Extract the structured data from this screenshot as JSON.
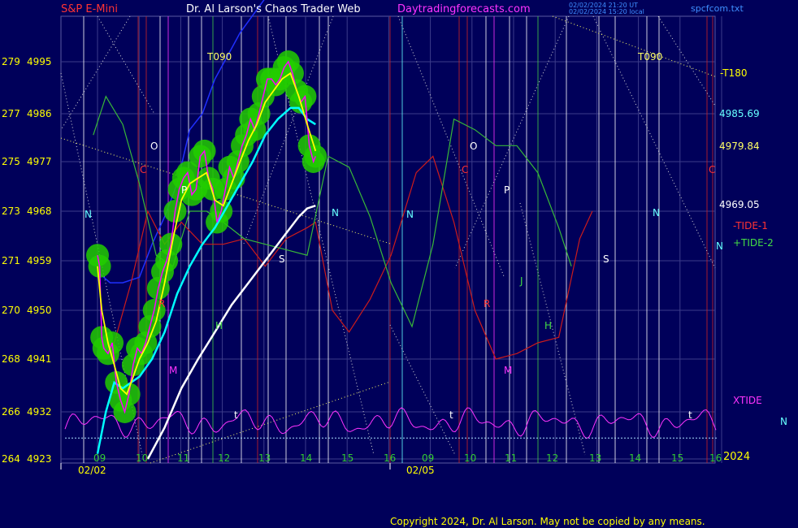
{
  "header": {
    "symbol": "S&P E-Mini",
    "title": "Dr. Al Larson's Chaos Trader Web",
    "site": "Daytradingforecasts.com",
    "stamp1": "02/02/2024 21:20 UT",
    "stamp2": "02/02/2024 15:20 local",
    "file": "spcfcom.txt"
  },
  "footer": {
    "copyright": "Copyright 2024, Dr. Al Larson. May not be copied by any means."
  },
  "colors": {
    "background": "#00005a",
    "grid": "#3c3c8a",
    "price": "#ffff00",
    "ma_fast": "#ff00ff",
    "ma_slow": "#00ffff",
    "halo": "#22cc00",
    "tide1": "#cc1b1b",
    "tide2": "#38b838",
    "xtide": "#ff33ff",
    "long_avg": "#ffffff",
    "blue_line": "#2030ff"
  },
  "chart_data": {
    "type": "line",
    "title": "S&P E-Mini",
    "y_axis": {
      "ticks": [
        {
          "planet": "264",
          "price": "4923"
        },
        {
          "planet": "266",
          "price": "4932"
        },
        {
          "planet": "268",
          "price": "4941"
        },
        {
          "planet": "270",
          "price": "4950"
        },
        {
          "planet": "271",
          "price": "4959"
        },
        {
          "planet": "273",
          "price": "4968"
        },
        {
          "planet": "275",
          "price": "4977"
        },
        {
          "planet": "277",
          "price": "4986"
        },
        {
          "planet": "279",
          "price": "4995"
        }
      ],
      "range": [
        4923,
        5000
      ]
    },
    "x_axis": {
      "hour_labels_day1": [
        "09",
        "10",
        "11",
        "12",
        "13",
        "14",
        "15",
        "16"
      ],
      "hour_labels_day2": [
        "09",
        "10",
        "11",
        "12",
        "13",
        "14",
        "15",
        "16"
      ],
      "date_labels": [
        "02/02",
        "02/05"
      ],
      "year_label": "2024"
    },
    "right_labels": [
      {
        "text": "-T180",
        "value": 4996
      },
      {
        "text": "4985.69",
        "value": 4985.69
      },
      {
        "text": "4979.84",
        "value": 4979.84
      },
      {
        "text": "4969.05",
        "value": 4969.05
      }
    ],
    "legend": [
      "-TIDE-1",
      "+TIDE-2",
      "XTIDE",
      "N"
    ],
    "markers": [
      "T090",
      "T090",
      "O",
      "O",
      "P",
      "P",
      "C",
      "C",
      "C",
      "N",
      "N",
      "N",
      "N",
      "N",
      "S",
      "S",
      "H",
      "H",
      "M",
      "M",
      "R",
      "R",
      "J",
      "t",
      "t",
      "t"
    ],
    "price_series": [
      [
        9.0,
        4960
      ],
      [
        9.05,
        4958
      ],
      [
        9.1,
        4945
      ],
      [
        9.15,
        4943
      ],
      [
        9.25,
        4942
      ],
      [
        9.35,
        4944
      ],
      [
        9.45,
        4937
      ],
      [
        9.55,
        4934
      ],
      [
        9.65,
        4932
      ],
      [
        9.75,
        4935
      ],
      [
        9.85,
        4940
      ],
      [
        9.95,
        4943
      ],
      [
        10.05,
        4942
      ],
      [
        10.15,
        4944
      ],
      [
        10.25,
        4947
      ],
      [
        10.35,
        4950
      ],
      [
        10.45,
        4954
      ],
      [
        10.55,
        4957
      ],
      [
        10.65,
        4959
      ],
      [
        10.75,
        4962
      ],
      [
        10.85,
        4968
      ],
      [
        10.95,
        4972
      ],
      [
        11.05,
        4974
      ],
      [
        11.15,
        4975
      ],
      [
        11.25,
        4971
      ],
      [
        11.35,
        4972
      ],
      [
        11.45,
        4978
      ],
      [
        11.55,
        4979
      ],
      [
        11.65,
        4974
      ],
      [
        11.75,
        4972
      ],
      [
        11.85,
        4966
      ],
      [
        11.95,
        4968
      ],
      [
        12.05,
        4972
      ],
      [
        12.15,
        4976
      ],
      [
        12.25,
        4974
      ],
      [
        12.35,
        4977
      ],
      [
        12.45,
        4980
      ],
      [
        12.55,
        4982
      ],
      [
        12.65,
        4985
      ],
      [
        12.75,
        4983
      ],
      [
        12.85,
        4986
      ],
      [
        12.95,
        4989
      ],
      [
        13.05,
        4992
      ],
      [
        13.15,
        4992
      ],
      [
        13.25,
        4991
      ],
      [
        13.35,
        4992
      ],
      [
        13.45,
        4994
      ],
      [
        13.55,
        4995
      ],
      [
        13.65,
        4993
      ],
      [
        13.75,
        4990
      ],
      [
        13.85,
        4988
      ],
      [
        13.95,
        4989
      ],
      [
        14.05,
        4980
      ],
      [
        14.15,
        4977
      ],
      [
        14.2,
        4978
      ]
    ],
    "ma_fast_series": [
      [
        9.0,
        4958
      ],
      [
        9.1,
        4950
      ],
      [
        9.25,
        4944
      ],
      [
        9.4,
        4940
      ],
      [
        9.55,
        4936
      ],
      [
        9.7,
        4935
      ],
      [
        9.85,
        4938
      ],
      [
        10.0,
        4941
      ],
      [
        10.2,
        4944
      ],
      [
        10.4,
        4948
      ],
      [
        10.6,
        4955
      ],
      [
        10.8,
        4963
      ],
      [
        11.0,
        4970
      ],
      [
        11.2,
        4973
      ],
      [
        11.4,
        4974
      ],
      [
        11.6,
        4975
      ],
      [
        11.8,
        4970
      ],
      [
        12.0,
        4969
      ],
      [
        12.2,
        4973
      ],
      [
        12.4,
        4977
      ],
      [
        12.6,
        4981
      ],
      [
        12.8,
        4984
      ],
      [
        13.0,
        4988
      ],
      [
        13.2,
        4990
      ],
      [
        13.4,
        4992
      ],
      [
        13.6,
        4993
      ],
      [
        13.8,
        4989
      ],
      [
        14.0,
        4984
      ],
      [
        14.2,
        4979
      ]
    ],
    "ma_slow_series": [
      [
        9.0,
        4924
      ],
      [
        9.2,
        4932
      ],
      [
        9.4,
        4937
      ],
      [
        9.6,
        4936
      ],
      [
        9.8,
        4937
      ],
      [
        10.0,
        4938
      ],
      [
        10.3,
        4941
      ],
      [
        10.6,
        4946
      ],
      [
        10.9,
        4953
      ],
      [
        11.2,
        4958
      ],
      [
        11.5,
        4962
      ],
      [
        11.8,
        4965
      ],
      [
        12.1,
        4969
      ],
      [
        12.4,
        4973
      ],
      [
        12.7,
        4977
      ],
      [
        13.0,
        4982
      ],
      [
        13.3,
        4985
      ],
      [
        13.6,
        4987
      ],
      [
        13.8,
        4987
      ],
      [
        14.0,
        4985
      ],
      [
        14.2,
        4984
      ]
    ],
    "long_avg_series": [
      [
        10.2,
        4923
      ],
      [
        10.6,
        4929
      ],
      [
        11.0,
        4936
      ],
      [
        11.4,
        4941
      ],
      [
        11.8,
        4946
      ],
      [
        12.2,
        4951
      ],
      [
        12.6,
        4955
      ],
      [
        13.0,
        4959
      ],
      [
        13.4,
        4963
      ],
      [
        13.8,
        4967
      ],
      [
        14.0,
        4968.5
      ],
      [
        14.2,
        4969
      ]
    ],
    "blue_series": [
      [
        9.0,
        4957
      ],
      [
        9.3,
        4955
      ],
      [
        9.6,
        4955
      ],
      [
        10.0,
        4956
      ],
      [
        10.3,
        4962
      ],
      [
        10.6,
        4967
      ],
      [
        10.9,
        4973
      ],
      [
        11.2,
        4983
      ],
      [
        11.5,
        4986
      ],
      [
        11.8,
        4992
      ],
      [
        12.1,
        4996
      ],
      [
        12.4,
        5000
      ],
      [
        12.7,
        5003
      ],
      [
        13.0,
        5006
      ]
    ],
    "tide1_series": [
      [
        9.0,
        4943
      ],
      [
        9.4,
        4944
      ],
      [
        9.8,
        4955
      ],
      [
        10.2,
        4968
      ],
      [
        10.6,
        4962
      ],
      [
        11.0,
        4966
      ],
      [
        11.5,
        4962
      ],
      [
        12.0,
        4962
      ],
      [
        12.5,
        4963
      ],
      [
        13.0,
        4958
      ],
      [
        13.5,
        4963
      ],
      [
        14.0,
        4965
      ],
      [
        14.2,
        4966
      ],
      [
        14.6,
        4950
      ],
      [
        15.0,
        4946
      ],
      [
        15.5,
        4952
      ],
      [
        16.0,
        4960
      ],
      [
        16.6,
        4975
      ],
      [
        17.0,
        4978
      ],
      [
        17.5,
        4966
      ],
      [
        18.0,
        4950
      ],
      [
        18.5,
        4941
      ],
      [
        19.0,
        4942
      ],
      [
        19.5,
        4944
      ],
      [
        20.0,
        4945
      ],
      [
        20.5,
        4963
      ],
      [
        20.8,
        4968
      ]
    ],
    "tide2_series": [
      [
        8.9,
        4982
      ],
      [
        9.2,
        4989
      ],
      [
        9.6,
        4984
      ],
      [
        10.0,
        4973
      ],
      [
        10.4,
        4960
      ],
      [
        10.8,
        4958
      ],
      [
        11.2,
        4968
      ],
      [
        11.6,
        4968
      ],
      [
        12.0,
        4966
      ],
      [
        12.5,
        4963
      ],
      [
        13.0,
        4962
      ],
      [
        13.5,
        4961
      ],
      [
        14.0,
        4960
      ],
      [
        14.5,
        4978
      ],
      [
        15.0,
        4976
      ],
      [
        15.5,
        4967
      ],
      [
        16.0,
        4955
      ],
      [
        16.5,
        4947
      ],
      [
        17.0,
        4962
      ],
      [
        17.5,
        4985
      ],
      [
        18.0,
        4983
      ],
      [
        18.5,
        4980
      ],
      [
        19.0,
        4980
      ],
      [
        19.5,
        4975
      ],
      [
        20.0,
        4965
      ],
      [
        20.3,
        4958
      ]
    ],
    "xtide_baseline": 4927
  }
}
